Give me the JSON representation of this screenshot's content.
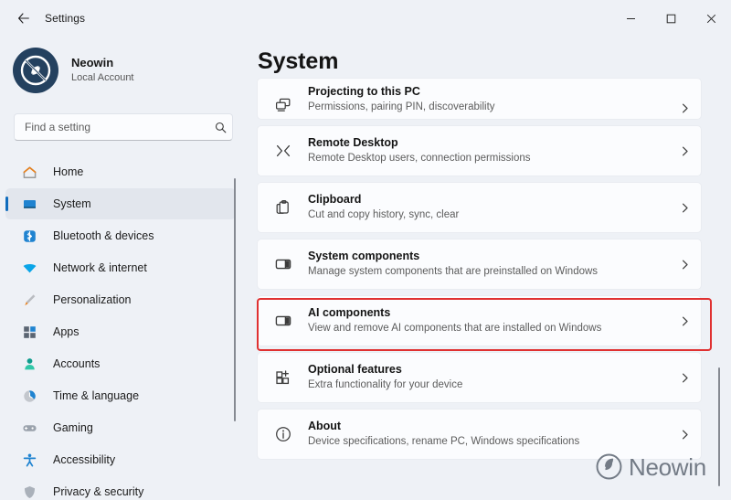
{
  "window": {
    "title": "Settings",
    "back_icon": "arrow-left-icon",
    "controls": [
      {
        "name": "minimize-button",
        "glyph": "–"
      },
      {
        "name": "maximize-button",
        "glyph": "□"
      },
      {
        "name": "close-button",
        "glyph": "✕"
      }
    ]
  },
  "sidebar": {
    "profile": {
      "name": "Neowin",
      "account_type": "Local Account",
      "avatar_icon": "neowin-logo-avatar"
    },
    "search": {
      "placeholder": "Find a setting",
      "value": "",
      "icon": "search-icon"
    },
    "items": [
      {
        "label": "Home",
        "icon": "home-icon",
        "active": false
      },
      {
        "label": "System",
        "icon": "system-monitor-icon",
        "active": true
      },
      {
        "label": "Bluetooth & devices",
        "icon": "bluetooth-icon",
        "active": false
      },
      {
        "label": "Network & internet",
        "icon": "wifi-icon",
        "active": false
      },
      {
        "label": "Personalization",
        "icon": "paintbrush-icon",
        "active": false
      },
      {
        "label": "Apps",
        "icon": "apps-grid-icon",
        "active": false
      },
      {
        "label": "Accounts",
        "icon": "person-icon",
        "active": false
      },
      {
        "label": "Time & language",
        "icon": "clock-globe-icon",
        "active": false
      },
      {
        "label": "Gaming",
        "icon": "gamepad-icon",
        "active": false
      },
      {
        "label": "Accessibility",
        "icon": "accessibility-person-icon",
        "active": false
      },
      {
        "label": "Privacy & security",
        "icon": "shield-icon",
        "active": false
      }
    ]
  },
  "main": {
    "title": "System",
    "cards": [
      {
        "title": "Projecting to this PC",
        "subtitle": "Permissions, pairing PIN, discoverability",
        "icon": "project-screens-icon",
        "highlighted": false
      },
      {
        "title": "Remote Desktop",
        "subtitle": "Remote Desktop users, connection permissions",
        "icon": "remote-desktop-icon",
        "highlighted": false
      },
      {
        "title": "Clipboard",
        "subtitle": "Cut and copy history, sync, clear",
        "icon": "clipboard-icon",
        "highlighted": false
      },
      {
        "title": "System components",
        "subtitle": "Manage system components that are preinstalled on Windows",
        "icon": "system-components-icon",
        "highlighted": false
      },
      {
        "title": "AI components",
        "subtitle": "View and remove AI components that are installed on Windows",
        "icon": "ai-components-icon",
        "highlighted": true
      },
      {
        "title": "Optional features",
        "subtitle": "Extra functionality for your device",
        "icon": "optional-features-icon",
        "highlighted": false
      },
      {
        "title": "About",
        "subtitle": "Device specifications, rename PC, Windows specifications",
        "icon": "info-circle-icon",
        "highlighted": false
      }
    ],
    "chevron_icon": "chevron-right-icon"
  },
  "watermark": {
    "text": "Neowin",
    "icon": "neowin-logo-icon"
  },
  "colors": {
    "highlight_border": "#e03131",
    "accent": "#0f6cbd",
    "window_background": "#eef1f6",
    "card_background": "#fbfcfe"
  }
}
